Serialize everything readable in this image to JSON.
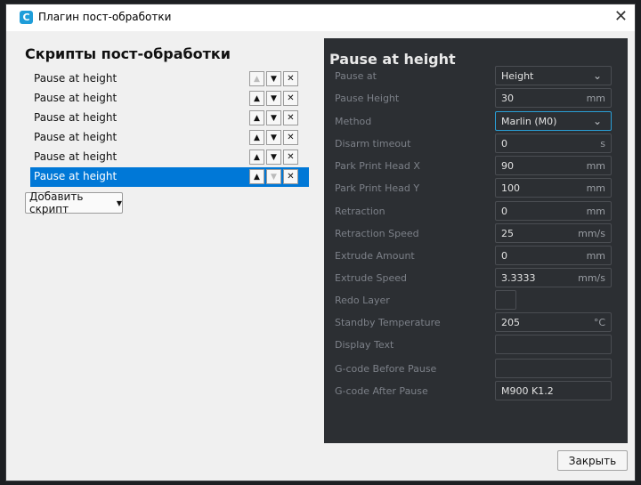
{
  "window": {
    "title": "Плагин пост-обработки",
    "icon": "cura-logo-icon",
    "close_glyph": "✕"
  },
  "left": {
    "heading": "Скрипты пост-обработки",
    "scripts": [
      {
        "label": "Pause at height",
        "selected": false
      },
      {
        "label": "Pause at height",
        "selected": false
      },
      {
        "label": "Pause at height",
        "selected": false
      },
      {
        "label": "Pause at height",
        "selected": false
      },
      {
        "label": "Pause at height",
        "selected": false
      },
      {
        "label": "Pause at height",
        "selected": true
      }
    ],
    "add_button": "Добавить скрипт"
  },
  "right": {
    "title": "Pause at height",
    "settings": [
      {
        "label": "Pause at",
        "value": "Height",
        "unit": "",
        "kind": "dropdown"
      },
      {
        "label": "Pause Height",
        "value": "30",
        "unit": "mm",
        "kind": "input"
      },
      {
        "label": "Method",
        "value": "Marlin (M0)",
        "unit": "",
        "kind": "dropdown",
        "focused": true
      },
      {
        "label": "Disarm timeout",
        "value": "0",
        "unit": "s",
        "kind": "input"
      },
      {
        "label": "Park Print Head X",
        "value": "90",
        "unit": "mm",
        "kind": "input"
      },
      {
        "label": "Park Print Head Y",
        "value": "100",
        "unit": "mm",
        "kind": "input"
      },
      {
        "label": "Retraction",
        "value": "0",
        "unit": "mm",
        "kind": "input"
      },
      {
        "label": "Retraction Speed",
        "value": "25",
        "unit": "mm/s",
        "kind": "input"
      },
      {
        "label": "Extrude Amount",
        "value": "0",
        "unit": "mm",
        "kind": "input"
      },
      {
        "label": "Extrude Speed",
        "value": "3.3333",
        "unit": "mm/s",
        "kind": "input"
      },
      {
        "label": "Redo Layer",
        "value": "",
        "unit": "",
        "kind": "checkbox"
      },
      {
        "label": "Standby Temperature",
        "value": "205",
        "unit": "°C",
        "kind": "input"
      },
      {
        "label": "Display Text",
        "value": "",
        "unit": "",
        "kind": "input"
      },
      {
        "label": "G-code Before Pause",
        "value": "",
        "unit": "",
        "kind": "input"
      },
      {
        "label": "G-code After Pause",
        "value": "M900 K1.2",
        "unit": "",
        "kind": "input"
      }
    ]
  },
  "footer": {
    "close_button": "Закрыть"
  },
  "colors": {
    "selection": "#0078d7",
    "panel": "#2c2f33",
    "focus": "#2a9fd6"
  }
}
